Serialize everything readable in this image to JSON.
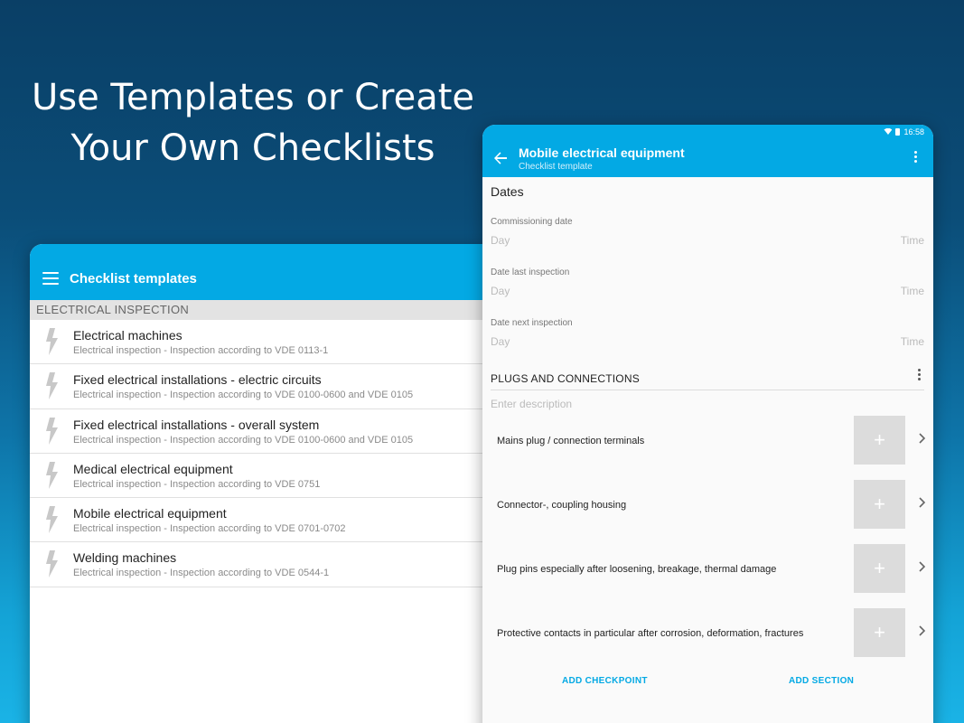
{
  "headline": {
    "line1": "Use Templates or Create",
    "line2": "Your Own Checklists"
  },
  "templates_screen": {
    "appbar_title": "Checklist templates",
    "section_header": "ELECTRICAL INSPECTION",
    "items": [
      {
        "name": "Electrical machines",
        "sub": "Electrical inspection - Inspection according to VDE 0113-1"
      },
      {
        "name": "Fixed electrical installations - electric circuits",
        "sub": "Electrical inspection - Inspection according to VDE 0100-0600 and VDE 0105"
      },
      {
        "name": "Fixed electrical installations - overall system",
        "sub": "Electrical inspection - Inspection according to VDE 0100-0600 and VDE 0105"
      },
      {
        "name": "Medical electrical equipment",
        "sub": "Electrical inspection - Inspection according to VDE 0751"
      },
      {
        "name": "Mobile electrical equipment",
        "sub": "Electrical inspection - Inspection according to VDE 0701-0702"
      },
      {
        "name": "Welding machines",
        "sub": "Electrical inspection - Inspection according to VDE 0544-1"
      }
    ]
  },
  "detail_screen": {
    "status_time": "16:58",
    "title": "Mobile electrical equipment",
    "subtitle": "Checklist template",
    "dates_title": "Dates",
    "dates": [
      {
        "label": "Commissioning date",
        "day": "Day",
        "time": "Time"
      },
      {
        "label": "Date last inspection",
        "day": "Day",
        "time": "Time"
      },
      {
        "label": "Date next inspection",
        "day": "Day",
        "time": "Time"
      }
    ],
    "section_title": "PLUGS AND CONNECTIONS",
    "description_placeholder": "Enter description",
    "checkpoints": [
      {
        "label": "Mains plug / connection terminals"
      },
      {
        "label": "Connector-, coupling housing"
      },
      {
        "label": "Plug pins especially after loosening, breakage, thermal damage"
      },
      {
        "label": "Protective contacts in particular after corrosion, deformation, fractures"
      }
    ],
    "add_checkpoint": "ADD CHECKPOINT",
    "add_section": "ADD SECTION"
  },
  "colors": {
    "accent": "#03a9e4",
    "bg_top": "#0a3f66",
    "bg_bottom": "#1ab3e6"
  }
}
